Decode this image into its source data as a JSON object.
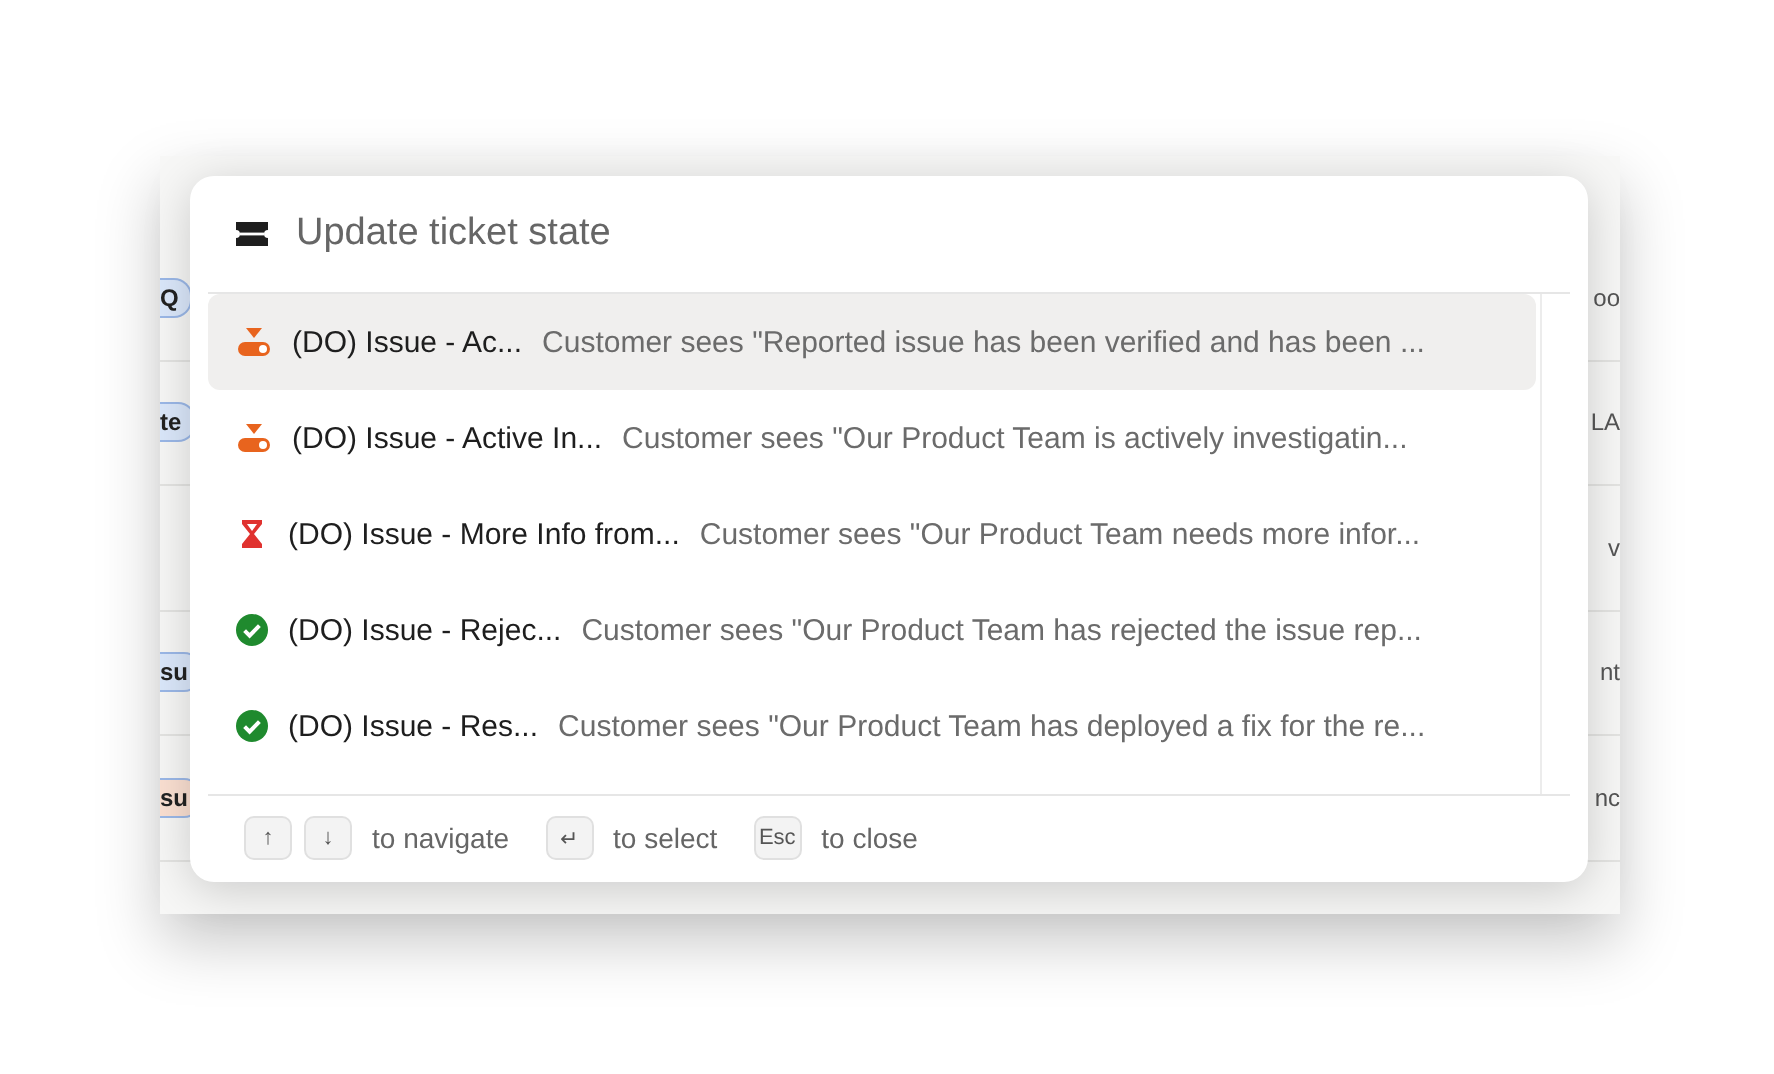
{
  "background_table": {
    "rows": [
      {
        "tag": {
          "text": "Q",
          "color": "#dbe8fb"
        },
        "column_3": "oo"
      },
      {
        "tag": {
          "text": "te",
          "color": "#dbe8fb"
        },
        "column_3": "LA"
      },
      {
        "column_3": "v"
      },
      {
        "tag": {
          "text": "su",
          "color": "#dbe8fb"
        },
        "column_3": "nt"
      },
      {
        "tag": {
          "text": "su",
          "color": "#fbe0d2"
        },
        "column_3": "nc"
      }
    ]
  },
  "dialog": {
    "title": "Update ticket state",
    "options": [
      {
        "kind": "active",
        "name": "(DO) Issue - Ac...",
        "description": "Customer sees \"Reported issue has been verified and has been ...",
        "selected": true
      },
      {
        "kind": "active",
        "name": "(DO) Issue - Active In...",
        "description": "Customer sees \"Our Product Team is actively investigatin...",
        "selected": false
      },
      {
        "kind": "waiting",
        "name": "(DO) Issue - More Info from...",
        "description": "Customer sees \"Our Product Team needs more infor...",
        "selected": false
      },
      {
        "kind": "resolved",
        "name": "(DO) Issue - Rejec...",
        "description": "Customer sees \"Our Product Team has rejected the issue rep...",
        "selected": false
      },
      {
        "kind": "resolved",
        "name": "(DO) Issue - Res...",
        "description": "Customer sees \"Our Product Team has deployed a fix for the re...",
        "selected": false
      }
    ],
    "hints": [
      {
        "keys": [
          "↑",
          "↓"
        ],
        "label": "to navigate"
      },
      {
        "keys": [
          "↵"
        ],
        "label": "to select"
      },
      {
        "keys": [
          "Esc"
        ],
        "label": "to close"
      }
    ]
  }
}
